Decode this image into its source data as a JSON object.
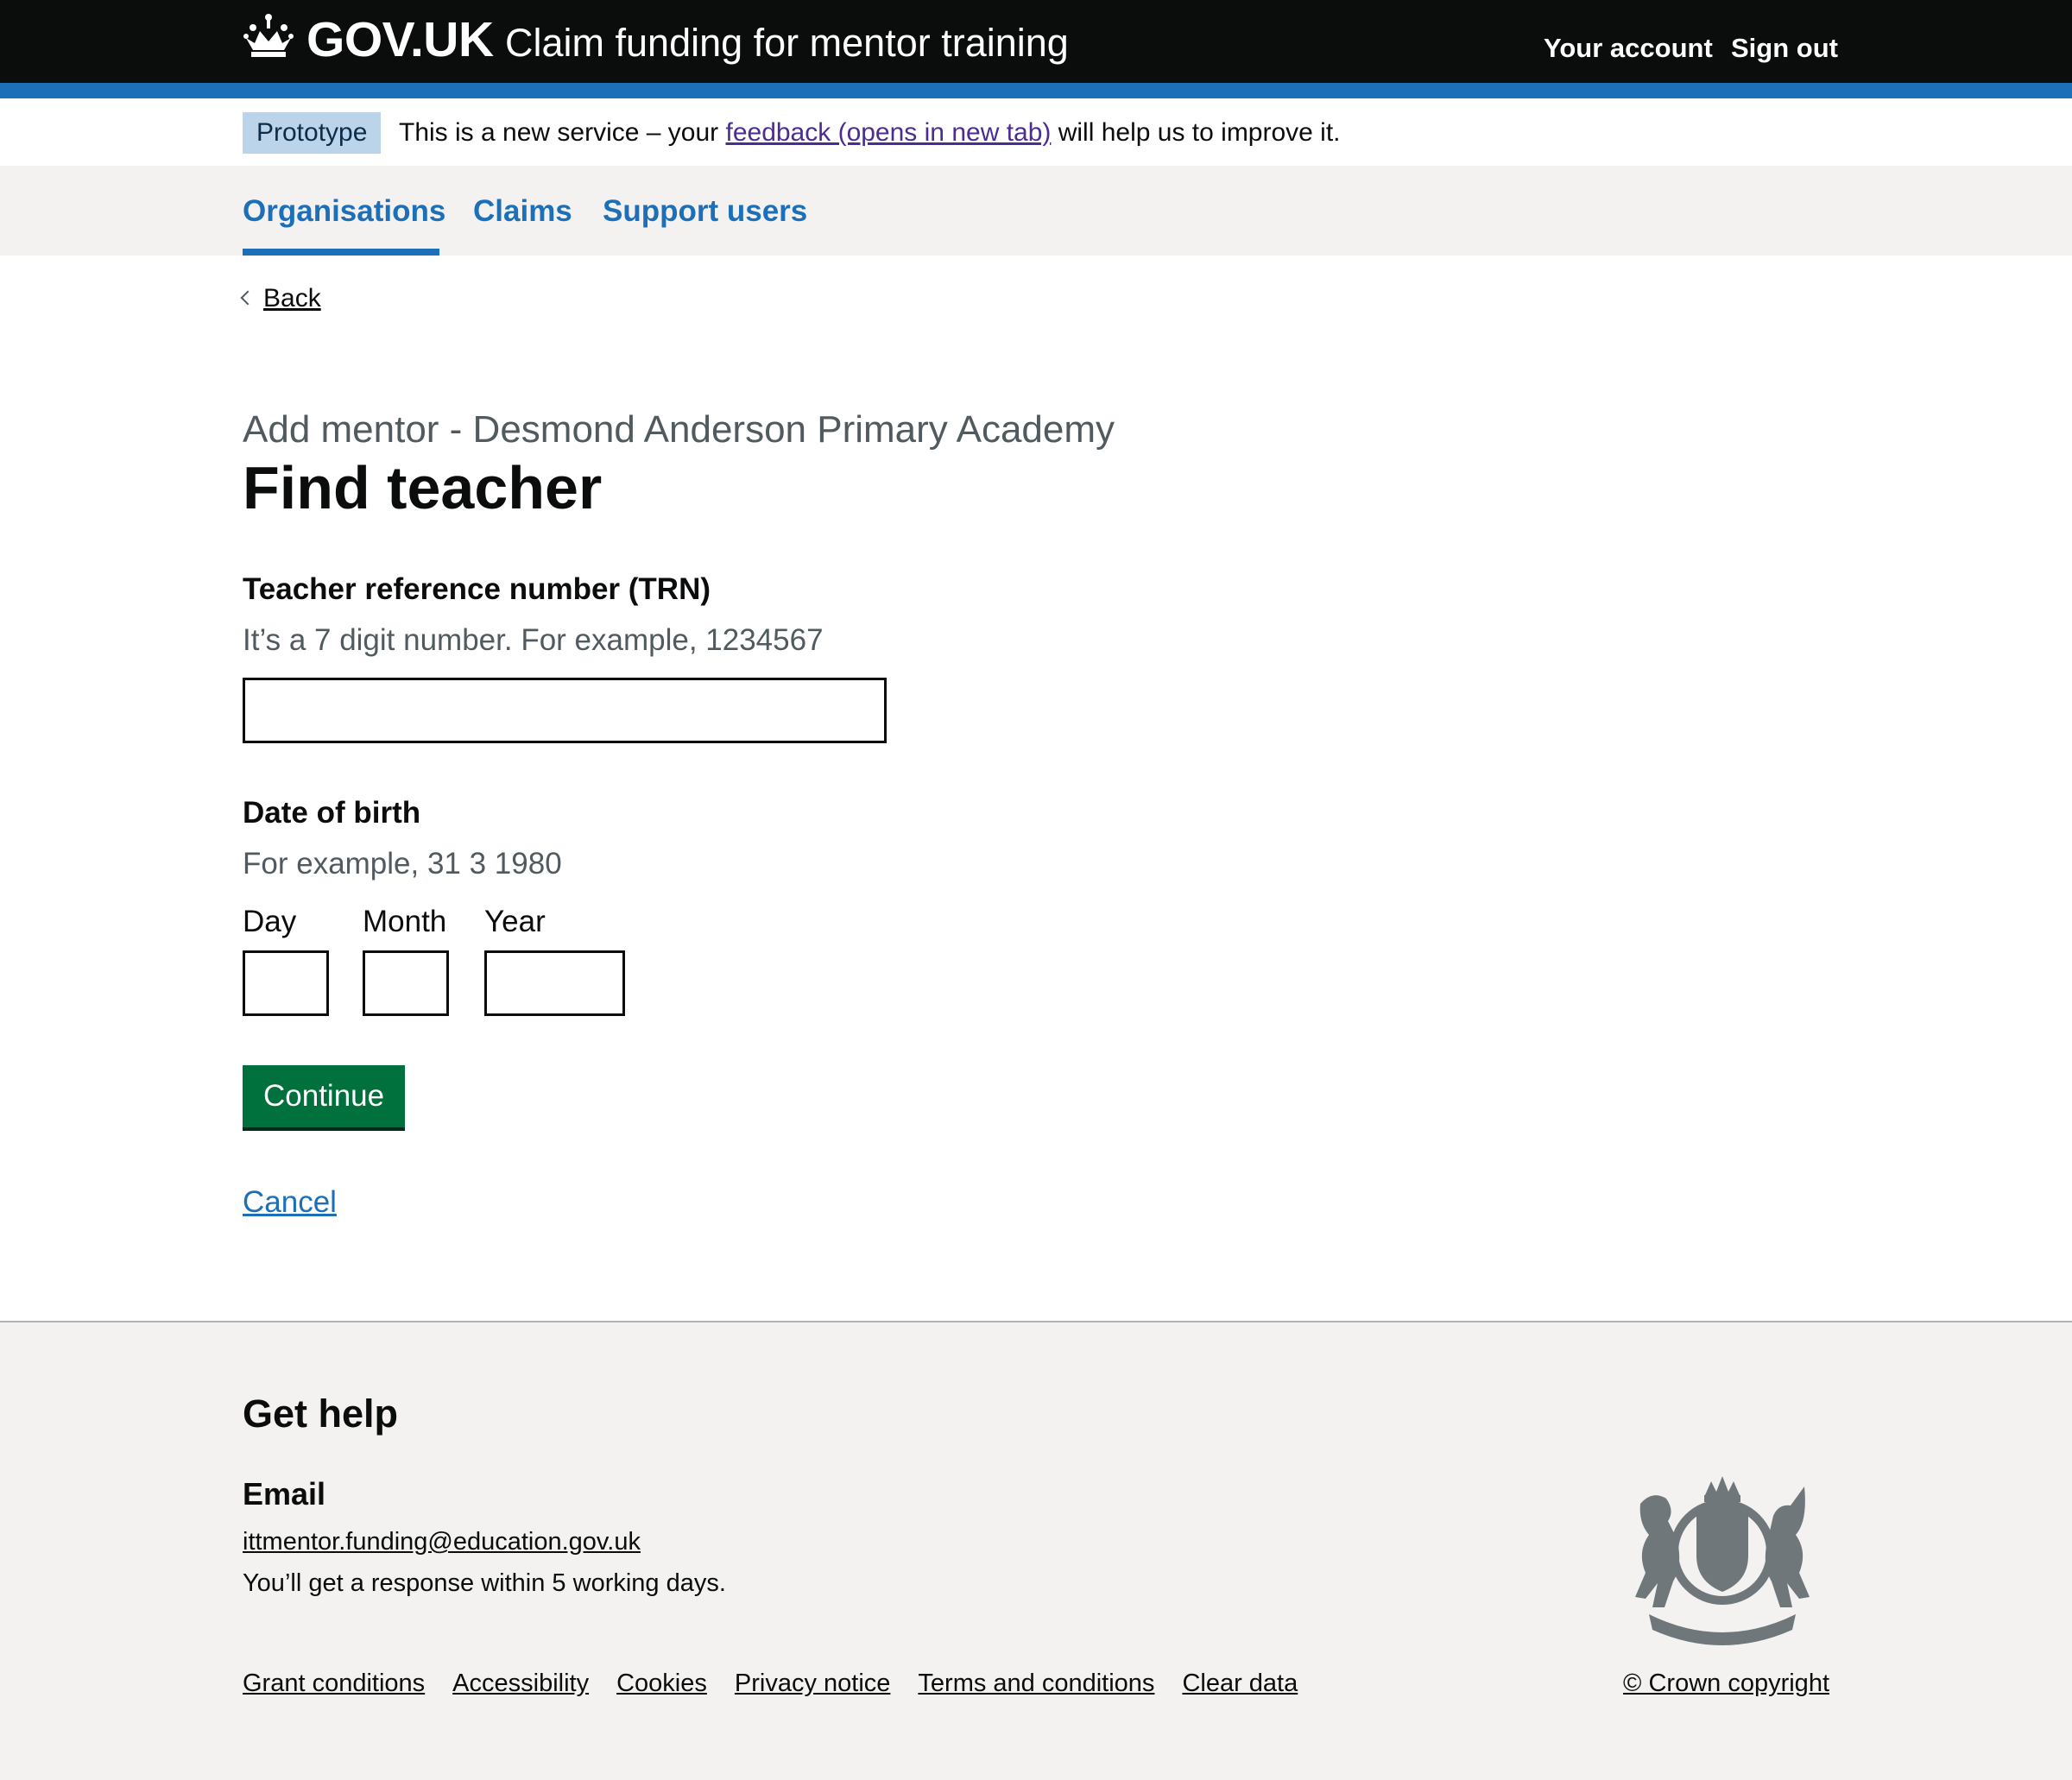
{
  "header": {
    "logo_text": "GOV.UK",
    "service_name": "Claim funding for mentor training",
    "your_account": "Your account",
    "sign_out": "Sign out"
  },
  "phase_banner": {
    "tag": "Prototype",
    "text_before": "This is a new service – your ",
    "link": "feedback (opens in new tab)",
    "text_after": " will help us to improve it."
  },
  "nav": {
    "items": [
      {
        "label": "Organisations",
        "active": true
      },
      {
        "label": "Claims",
        "active": false
      },
      {
        "label": "Support users",
        "active": false
      }
    ]
  },
  "back_link": "Back",
  "caption": "Add mentor - Desmond Anderson Primary Academy",
  "title": "Find teacher",
  "trn": {
    "label": "Teacher reference number (TRN)",
    "hint": "It’s a 7 digit number. For example, 1234567",
    "value": ""
  },
  "dob": {
    "legend": "Date of birth",
    "hint": "For example, 31 3 1980",
    "day_label": "Day",
    "month_label": "Month",
    "year_label": "Year",
    "day_value": "",
    "month_value": "",
    "year_value": ""
  },
  "continue_button": "Continue",
  "cancel_link": "Cancel",
  "footer": {
    "heading": "Get help",
    "email_heading": "Email",
    "email": "ittmentor.funding@education.gov.uk",
    "response": "You’ll get a response within 5 working days.",
    "links": [
      "Grant conditions",
      "Accessibility",
      "Cookies",
      "Privacy notice",
      "Terms and conditions",
      "Clear data"
    ],
    "copyright": "© Crown copyright"
  },
  "colors": {
    "header_bg": "#0b0c0c",
    "brand_blue": "#1d70b8",
    "button_green": "#00703c",
    "footer_bg": "#f3f2f1"
  }
}
